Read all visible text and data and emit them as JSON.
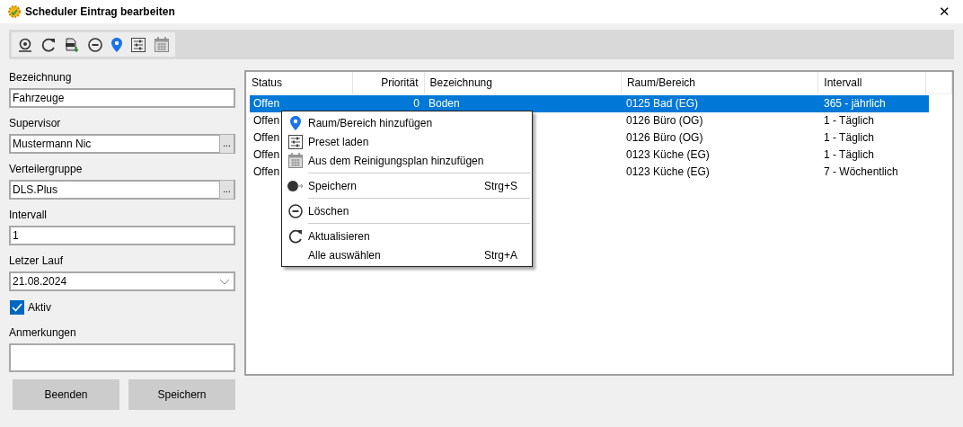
{
  "window": {
    "title": "Scheduler Eintrag bearbeiten",
    "close": "✕"
  },
  "form": [
    {
      "kind": "text",
      "label": "Bezeichnung",
      "value": "Fahrzeuge"
    },
    {
      "kind": "lookup",
      "label": "Supervisor",
      "value": "Mustermann Nic",
      "button": "..."
    },
    {
      "kind": "lookup",
      "label": "Verteilergruppe",
      "value": "DLS.Plus",
      "button": "..."
    },
    {
      "kind": "text",
      "label": "Intervall",
      "value": "1"
    },
    {
      "kind": "date",
      "label": "Letzer Lauf",
      "value": "21.08.2024"
    },
    {
      "kind": "checkbox",
      "label": "Aktiv",
      "checked": true
    },
    {
      "kind": "memo",
      "label": "Anmerkungen"
    }
  ],
  "buttons": [
    "Beenden",
    "Speichern"
  ],
  "table": {
    "columns": [
      "Status",
      "Priorität",
      "Bezeichnung",
      "Raum/Bereich",
      "Intervall"
    ],
    "rows": [
      {
        "selected": true,
        "cells": [
          "Offen",
          "0",
          "Boden",
          "0125 Bad (EG)",
          "365 - jährlich"
        ]
      },
      {
        "selected": false,
        "cells": [
          "Offen",
          "",
          "",
          "0126 Büro (OG)",
          "1 - Täglich"
        ]
      },
      {
        "selected": false,
        "cells": [
          "Offen",
          "",
          "",
          "0126 Büro (OG)",
          "1 - Täglich"
        ]
      },
      {
        "selected": false,
        "cells": [
          "Offen",
          "",
          "",
          "0123 Küche (EG)",
          "1 - Täglich"
        ]
      },
      {
        "selected": false,
        "cells": [
          "Offen",
          "",
          "",
          "0123 Küche (EG)",
          "7 - Wöchentlich"
        ]
      }
    ]
  },
  "context_menu": [
    [
      {
        "kind": "pin",
        "label": "Raum/Bereich hinzufügen"
      },
      {
        "kind": "preset",
        "label": "Preset laden"
      },
      {
        "kind": "calendar",
        "label": "Aus dem Reinigungsplan hinzufügen"
      }
    ],
    [
      {
        "kind": "save",
        "label": "Speichern",
        "shortcut": "Strg+S"
      }
    ],
    [
      {
        "kind": "delete",
        "label": "Löschen"
      }
    ],
    [
      {
        "kind": "refresh",
        "label": "Aktualisieren"
      },
      {
        "kind": "none",
        "label": "Alle auswählen",
        "shortcut": "Strg+A"
      }
    ]
  ]
}
